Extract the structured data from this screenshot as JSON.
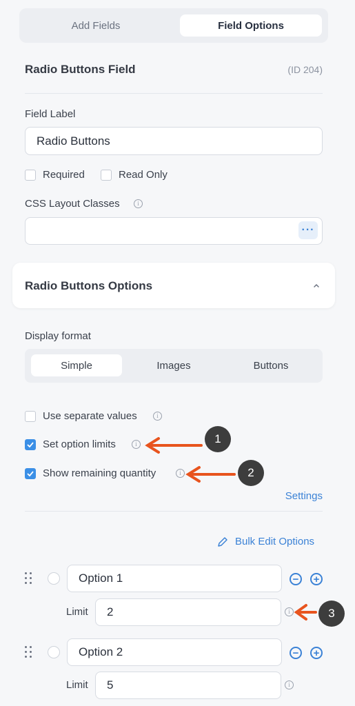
{
  "tabs": [
    {
      "label": "Add Fields",
      "active": false
    },
    {
      "label": "Field Options",
      "active": true
    }
  ],
  "field": {
    "title": "Radio Buttons Field",
    "id": "(ID 204)",
    "label_heading": "Field Label",
    "label_value": "Radio Buttons",
    "required_label": "Required",
    "required_checked": false,
    "readonly_label": "Read Only",
    "readonly_checked": false,
    "css_heading": "CSS Layout Classes",
    "css_value": "",
    "more_icon": "ellipsis-icon"
  },
  "options_section": {
    "title": "Radio Buttons Options",
    "collapse_icon": "chevron-up-icon",
    "display_format_label": "Display format",
    "formats": [
      {
        "label": "Simple",
        "active": true
      },
      {
        "label": "Images",
        "active": false
      },
      {
        "label": "Buttons",
        "active": false
      }
    ],
    "separate_values_label": "Use separate values",
    "separate_values_checked": false,
    "option_limits_label": "Set option limits",
    "option_limits_checked": true,
    "remaining_label": "Show remaining quantity",
    "remaining_checked": true,
    "settings_link": "Settings",
    "bulk_edit_link": "Bulk Edit Options"
  },
  "options": [
    {
      "value": "Option 1",
      "limit_label": "Limit",
      "limit": "2"
    },
    {
      "value": "Option 2",
      "limit_label": "Limit",
      "limit": "5"
    }
  ],
  "annotations": [
    {
      "number": "1"
    },
    {
      "number": "2"
    },
    {
      "number": "3"
    }
  ],
  "colors": {
    "accent": "#3b82d6",
    "checkbox": "#3b8fe6",
    "arrow": "#e8541e",
    "badge": "#3d3d3d"
  }
}
